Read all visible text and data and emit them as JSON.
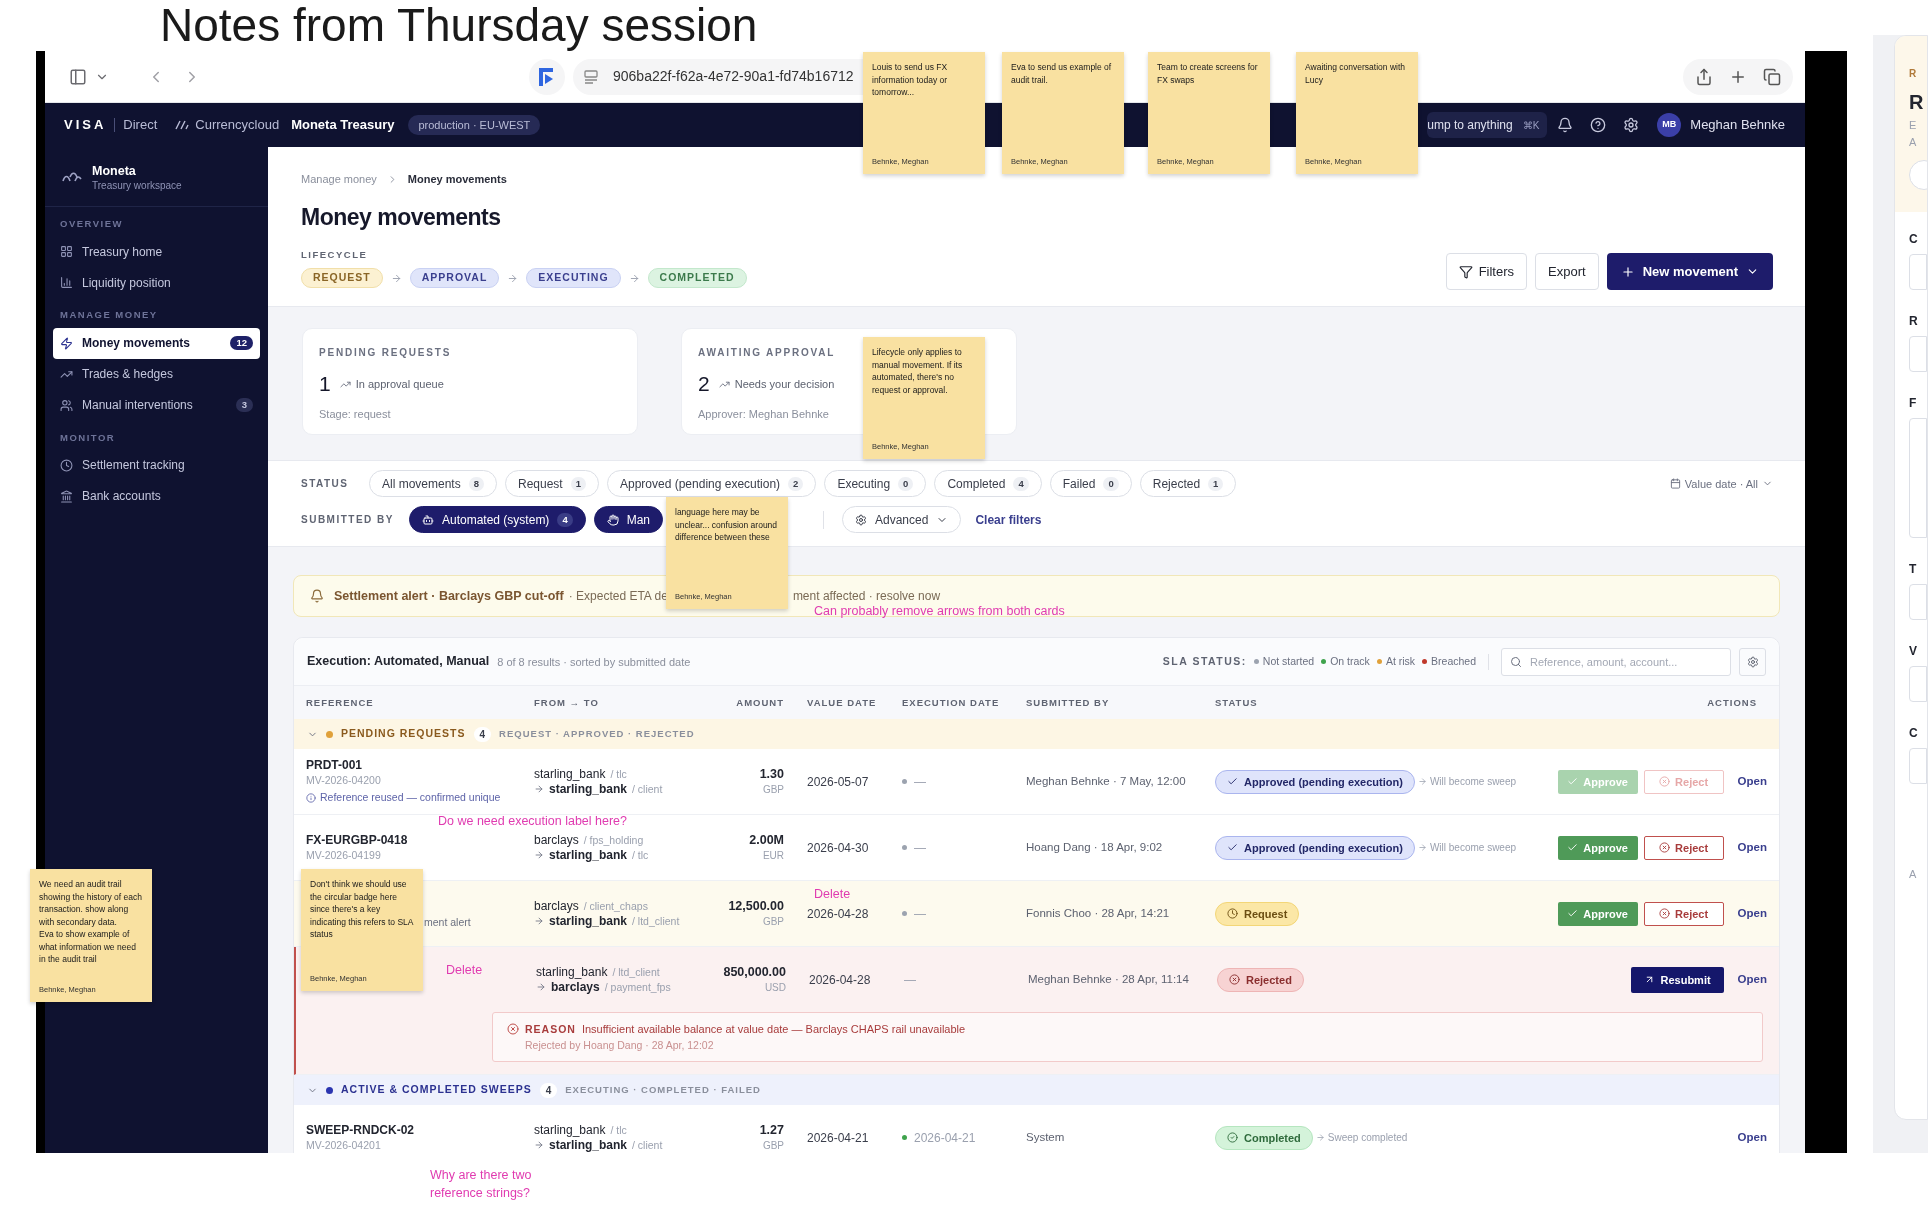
{
  "board": {
    "title": "Notes from Thursday session"
  },
  "browser": {
    "url": "906ba22f-f62a-4e72-90a1-fd74b16712"
  },
  "app_bar": {
    "brand": "VISA",
    "brand_sub": "Direct",
    "product": "Currencycloud",
    "workspace": "Moneta Treasury",
    "environment": "production · EU-WEST",
    "search": "ump to anything",
    "shortcut": "⌘K",
    "user_initials": "MB",
    "user_name": "Meghan Behnke"
  },
  "sidebar": {
    "name": "Moneta",
    "subtitle": "Treasury workspace",
    "sections": [
      {
        "title": "OVERVIEW",
        "items": [
          {
            "label": "Treasury home",
            "selected": false
          },
          {
            "label": "Liquidity position",
            "selected": false
          }
        ]
      },
      {
        "title": "MANAGE MONEY",
        "items": [
          {
            "label": "Money movements",
            "count": "12",
            "selected": true
          },
          {
            "label": "Trades & hedges",
            "selected": false
          },
          {
            "label": "Manual interventions",
            "count": "3",
            "selected": false
          }
        ]
      },
      {
        "title": "MONITOR",
        "items": [
          {
            "label": "Settlement tracking",
            "selected": false
          },
          {
            "label": "Bank accounts",
            "selected": false
          }
        ]
      }
    ]
  },
  "breadcrumb": [
    "Manage money",
    "Money movements"
  ],
  "page_title": "Money movements",
  "lifecycle": {
    "label": "LIFECYCLE",
    "stages": [
      {
        "label": "REQUEST",
        "kind": "request"
      },
      {
        "label": "APPROVAL",
        "kind": "approval"
      },
      {
        "label": "EXECUTING",
        "kind": "executing"
      },
      {
        "label": "COMPLETED",
        "kind": "completed"
      }
    ]
  },
  "header_buttons": [
    {
      "label": "Filters",
      "kind": "filter"
    },
    {
      "label": "Export",
      "kind": "plain"
    },
    {
      "label": "New movement",
      "kind": "primary"
    }
  ],
  "stat_cards": [
    {
      "label": "PENDING REQUESTS",
      "value": "1",
      "trend": "In approval queue",
      "footer": "Stage: request"
    },
    {
      "label": "AWAITING APPROVAL",
      "value": "2",
      "trend": "Needs your decision",
      "footer": "Approver: Meghan Behnke"
    }
  ],
  "status_filter": {
    "label": "STATUS",
    "chips": [
      {
        "label": "All movements",
        "count": "8",
        "selected": false
      },
      {
        "label": "Request",
        "count": "1",
        "selected": false
      },
      {
        "label": "Approved (pending execution)",
        "count": "2",
        "selected": false
      },
      {
        "label": "Executing",
        "count": "0",
        "selected": false
      },
      {
        "label": "Completed",
        "count": "4",
        "selected": false
      },
      {
        "label": "Failed",
        "count": "0",
        "selected": false
      },
      {
        "label": "Rejected",
        "count": "1",
        "selected": false
      }
    ],
    "date_filter": "Value date · All"
  },
  "submitted_filter": {
    "label": "SUBMITTED BY",
    "chips": [
      {
        "label": "Automated (system)",
        "count": "4",
        "selected": true
      },
      {
        "label": "Man",
        "selected": true
      }
    ],
    "advanced": "Advanced",
    "clear": "Clear filters"
  },
  "alert": {
    "title": "Settlement alert · Barclays GBP cut-off",
    "detail": "· Expected ETA de",
    "tail": "ment affected · resolve now"
  },
  "table": {
    "title": "Execution: Automated, Manual",
    "summary": "8 of 8 results · sorted by submitted date",
    "sla_label": "SLA STATUS:",
    "sla_legend": [
      {
        "label": "Not started",
        "color": "#9ca3af"
      },
      {
        "label": "On track",
        "color": "#3fa34d"
      },
      {
        "label": "At risk",
        "color": "#e0a13a"
      },
      {
        "label": "Breached",
        "color": "#c0392b"
      }
    ],
    "search": {
      "placeholder": "Reference, amount, account..."
    },
    "columns": [
      "REFERENCE",
      "FROM → TO",
      "AMOUNT",
      "VALUE DATE",
      "EXECUTION DATE",
      "SUBMITTED BY",
      "STATUS",
      "ACTIONS"
    ],
    "groups": [
      {
        "title": "PENDING REQUESTS",
        "count": "4",
        "stages": "REQUEST · APPROVED · REJECTED",
        "color": "#e0a13a",
        "kind": "pending",
        "expanded": true,
        "rows": [
          {
            "kind": "normal",
            "reference": "PRDT-001",
            "movement_id": "MV-2026-04200",
            "ref_note": "Reference reused — confirmed unique",
            "from_account": "starling_bank",
            "from_sub": "/ tlc",
            "to_account": "starling_bank",
            "to_sub": "/ client",
            "amount": "1.30",
            "currency": "GBP",
            "value_date": "2026-05-07",
            "execution": {
              "color": "#9ca3af",
              "text": "—"
            },
            "submitted_by": "Meghan Behnke · 7 May, 12:00",
            "status": {
              "kind": "approved",
              "label": "Approved (pending execution)",
              "hint": "Will become sweep"
            },
            "actions": [
              {
                "kind": "approve",
                "label": "Approve",
                "disabled": true
              },
              {
                "kind": "reject",
                "label": "Reject",
                "disabled": true
              },
              {
                "kind": "open",
                "label": "Open",
                "disabled": false
              }
            ]
          },
          {
            "kind": "normal",
            "reference": "FX-EURGBP-0418",
            "movement_id": "MV-2026-04199",
            "from_account": "barclays",
            "from_sub": "/ fps_holding",
            "to_account": "starling_bank",
            "to_sub": "/ tlc",
            "amount": "2.00M",
            "currency": "EUR",
            "value_date": "2026-04-30",
            "execution": {
              "color": "#9ca3af",
              "text": "—"
            },
            "submitted_by": "Hoang Dang · 18 Apr, 9:02",
            "status": {
              "kind": "approved",
              "label": "Approved (pending execution)",
              "hint": "Will become sweep"
            },
            "actions": [
              {
                "kind": "approve",
                "label": "Approve",
                "disabled": false
              },
              {
                "kind": "reject",
                "label": "Reject",
                "disabled": false
              },
              {
                "kind": "open",
                "label": "Open",
                "disabled": false
              }
            ]
          },
          {
            "kind": "request",
            "alert_note": "ment alert",
            "from_account": "barclays",
            "from_sub": "/ client_chaps",
            "to_account": "starling_bank",
            "to_sub": "/ ltd_client",
            "amount": "12,500.00",
            "currency": "GBP",
            "value_date": "2026-04-28",
            "execution": {
              "color": "#9ca3af",
              "text": "—"
            },
            "submitted_by": "Fonnis Choo · 28 Apr, 14:21",
            "status": {
              "kind": "request",
              "label": "Request"
            },
            "actions": [
              {
                "kind": "approve",
                "label": "Approve",
                "disabled": false
              },
              {
                "kind": "reject",
                "label": "Reject",
                "disabled": false
              },
              {
                "kind": "open",
                "label": "Open",
                "disabled": false
              }
            ]
          },
          {
            "kind": "rejected",
            "from_account": "starling_bank",
            "from_sub": "/ ltd_client",
            "to_account": "barclays",
            "to_sub": "/ payment_fps",
            "amount": "850,000.00",
            "currency": "USD",
            "value_date": "2026-04-28",
            "execution": {
              "text": "—"
            },
            "submitted_by": "Meghan Behnke · 28 Apr, 11:14",
            "status": {
              "kind": "rejected",
              "label": "Rejected"
            },
            "actions": [
              {
                "kind": "resubmit",
                "label": "Resubmit",
                "disabled": false
              },
              {
                "kind": "open",
                "label": "Open",
                "disabled": false
              }
            ],
            "reason": {
              "label": "REASON",
              "text": "Insufficient available balance at value date — Barclays CHAPS rail unavailable",
              "meta": "Rejected by Hoang Dang · 28 Apr, 12:02"
            }
          }
        ]
      },
      {
        "title": "ACTIVE & COMPLETED SWEEPS",
        "count": "4",
        "stages": "EXECUTING · COMPLETED · FAILED",
        "color": "#2b35b0",
        "kind": "active",
        "expanded": true,
        "rows": [
          {
            "kind": "normal",
            "reference": "SWEEP-RNDCK-02",
            "movement_id": "MV-2026-04201",
            "from_account": "starling_bank",
            "from_sub": "/ tlc",
            "to_account": "starling_bank",
            "to_sub": "/ client",
            "amount": "1.27",
            "currency": "GBP",
            "value_date": "2026-04-21",
            "execution": {
              "color": "#3fa34d",
              "text": "2026-04-21"
            },
            "submitted_by": "System",
            "status": {
              "kind": "completed",
              "label": "Completed",
              "hint": "Sweep completed"
            },
            "actions": [
              {
                "kind": "open",
                "label": "Open",
                "disabled": false
              }
            ]
          }
        ]
      }
    ]
  },
  "side_panel": {
    "eyebrow": "R",
    "heading": "R",
    "meta": [
      "E",
      "A"
    ],
    "fields": [
      "C",
      "R",
      "F",
      "T",
      "V",
      "C"
    ],
    "footer": "A"
  },
  "sticky_notes": [
    {
      "text": "Louis to send us FX information today or tomorrow...",
      "author": "Behnke, Meghan"
    },
    {
      "text": "Eva to send us example of audit trail.",
      "author": "Behnke, Meghan"
    },
    {
      "text": "Team to create screens for FX swaps",
      "author": "Behnke, Meghan"
    },
    {
      "text": "Awaiting conversation with Lucy",
      "author": "Behnke, Meghan"
    },
    {
      "text": "Lifecycle only applies to manual movement. If its automated, there's no request or approval.",
      "author": "Behnke, Meghan"
    },
    {
      "text": "language here may be unclear... confusion around difference between these",
      "author": "Behnke, Meghan"
    },
    {
      "text": "We need an audit trail showing the history of each transaction. show along with secondary data.\nEva to show example of what information we need in the audit trail",
      "author": "Behnke, Meghan"
    },
    {
      "text": "Don't think we should use the circular badge here since there's a key indicating this refers to SLA status",
      "author": "Behnke, Meghan"
    }
  ],
  "comments": [
    "Can probably remove arrows from both cards",
    "Do we need execution label here?",
    "Delete",
    "Delete",
    "Why are there two reference strings?"
  ]
}
